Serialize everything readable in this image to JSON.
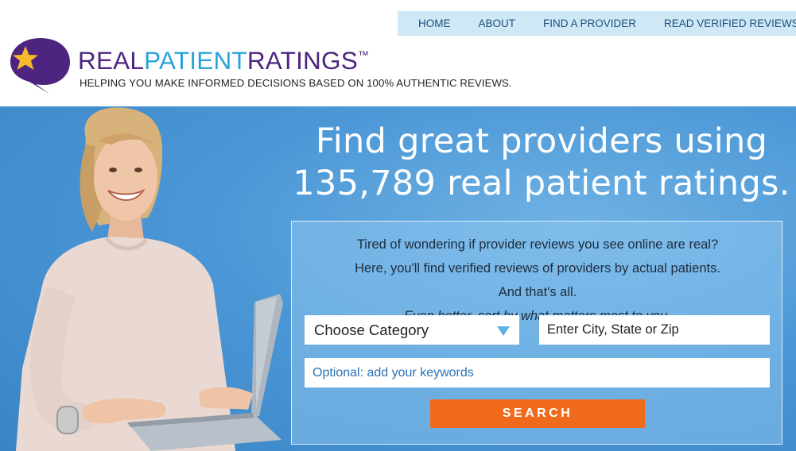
{
  "nav": {
    "items": [
      {
        "label": "HOME"
      },
      {
        "label": "ABOUT"
      },
      {
        "label": "FIND A PROVIDER"
      },
      {
        "label": "READ VERIFIED REVIEWS"
      }
    ]
  },
  "brand": {
    "part1": "REAL",
    "part2": "PATIENT",
    "part3": "RATINGS",
    "trademark": "™",
    "tagline": "HELPING YOU MAKE INFORMED DECISIONS BASED ON 100% AUTHENTIC REVIEWS."
  },
  "hero": {
    "headline_line1": "Find great providers using",
    "headline_line2": "135,789 real patient ratings."
  },
  "search": {
    "intro_line1": "Tired of wondering if provider reviews you see online are real?",
    "intro_line2": "Here, you'll find verified reviews of providers by actual patients.",
    "intro_line3_plain": "And that's all.",
    "intro_line3_em": "Even better, sort by what matters most to you.",
    "category_value": "Choose Category",
    "location_placeholder": "Enter City, State or Zip",
    "keywords_placeholder": "Optional: add your keywords",
    "button_label": "SEARCH"
  },
  "colors": {
    "brand_purple": "#4d2480",
    "brand_blue": "#2aa3d9",
    "nav_bg": "#cfe8f5",
    "hero_blue": "#4b97d6",
    "button_orange": "#ef6b1b"
  },
  "icons": {
    "logo": "speech-bubble-star-icon",
    "dropdown": "triangle-down-icon"
  }
}
